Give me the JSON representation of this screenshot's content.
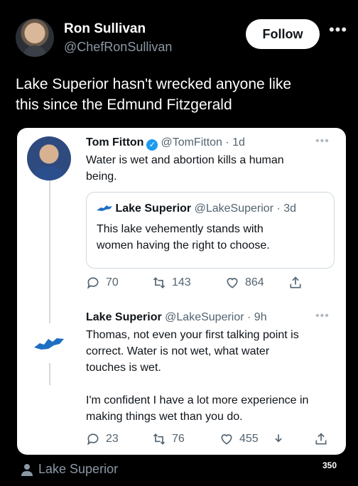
{
  "header": {
    "display_name": "Ron Sullivan",
    "handle": "@ChefRonSullivan",
    "follow_label": "Follow",
    "more_icon": "•••"
  },
  "tweet": {
    "line1": "Lake Superior hasn't wrecked anyone like",
    "line2": "this since the Edmund Fitzgerald"
  },
  "card": {
    "post1": {
      "name": "Tom Fitton",
      "handle": "@TomFitton",
      "age": "1d",
      "text_line1": "Water is wet and abortion kills a human",
      "text_line2": "being.",
      "quote": {
        "name": "Lake Superior",
        "handle": "@LakeSuperior",
        "age": "3d",
        "text_line1": "This lake vehemently stands with",
        "text_line2": "women having the right to choose."
      },
      "replies": "70",
      "retweets": "143",
      "likes": "864"
    },
    "post2": {
      "name": "Lake Superior",
      "handle": "@LakeSuperior",
      "age": "9h",
      "lines": [
        "Thomas, not even your first talking point is",
        "correct. Water is not wet, what water",
        "touches is wet.",
        "I'm confident I have a lot more experience in",
        "making things wet than you do."
      ],
      "replies": "23",
      "retweets": "76",
      "likes": "455"
    }
  },
  "footer": {
    "label": "Lake Superior",
    "count": "350"
  },
  "colors": {
    "background": "#000000",
    "accent": "#1d9bf0",
    "muted": "#536471"
  }
}
